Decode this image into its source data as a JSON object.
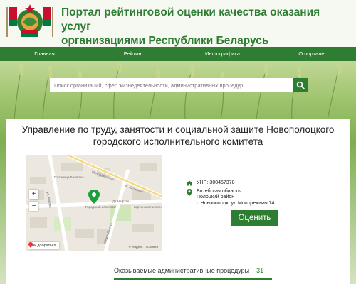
{
  "header": {
    "title_line1": "Портал рейтинговой оценки качества оказания услуг",
    "title_line2": "организациями Республики Беларусь"
  },
  "nav": {
    "items": [
      "Главная",
      "Рейтинг",
      "Инфографика",
      "О портале"
    ]
  },
  "search": {
    "placeholder": "Поиск организаций, сфер жизнедеятельности, административных процедур"
  },
  "organization": {
    "name_line1": "Управление по труду, занятости и социальной защите Новополоцкого",
    "name_line2": "городского исполнительного комитета",
    "unp": "УНП: 300457378",
    "address_line1": "Витебская область",
    "address_line2": "Полоцкий район",
    "address_line3": "г. Новополоцк, ул.Молодежная,74",
    "rate_button": "Оценить"
  },
  "map": {
    "streets": [
      "Молодёжная ул.",
      "ул. Калинина",
      "Юбилейная ул.",
      "ул. Кирова"
    ],
    "places": [
      "Гостиница Беларусь",
      "Городской исполком",
      "ДК Нафтан",
      "Картинная галерея"
    ],
    "zoom_in": "+",
    "zoom_out": "−",
    "route_label": "Как добраться",
    "attribution": "© Яндекс",
    "terms": "Условия"
  },
  "tabs": {
    "procedures_label": "Оказываемые административные процедуры",
    "procedures_count": "31"
  },
  "colors": {
    "brand_green": "#2e7d32",
    "field_green": "#7fae52",
    "card_bg": "#ffffff"
  }
}
